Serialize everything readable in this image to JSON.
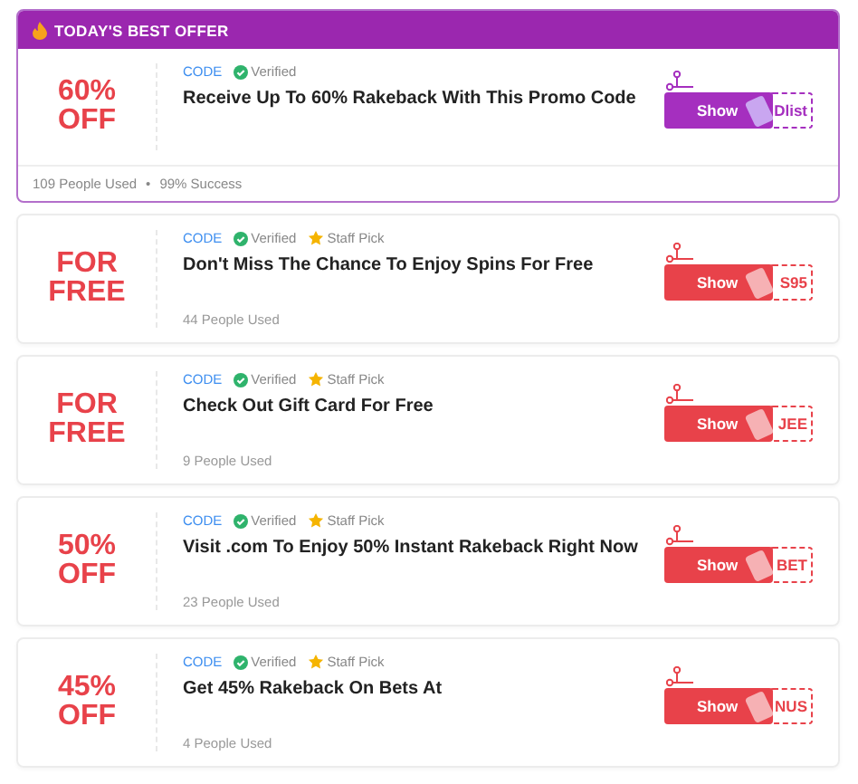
{
  "best_offer": {
    "header": "TODAY'S BEST OFFER",
    "discount": [
      "60%",
      "OFF"
    ],
    "tag": "CODE",
    "verified": "Verified",
    "title": "Receive Up To 60% Rakeback With This Promo Code",
    "button": "Show",
    "code": "Dlist",
    "used": "109 People Used",
    "separator": "•",
    "success": "99% Success"
  },
  "offers": [
    {
      "discount": [
        "FOR",
        "FREE"
      ],
      "tag": "CODE",
      "verified": "Verified",
      "staff_pick": "Staff Pick",
      "title": "Don't Miss The Chance To Enjoy Spins For Free",
      "used": "44 People Used",
      "button": "Show",
      "code": "S95"
    },
    {
      "discount": [
        "FOR",
        "FREE"
      ],
      "tag": "CODE",
      "verified": "Verified",
      "staff_pick": "Staff Pick",
      "title": "Check Out Gift Card For Free",
      "used": "9 People Used",
      "button": "Show",
      "code": "JEE"
    },
    {
      "discount": [
        "50%",
        "OFF"
      ],
      "tag": "CODE",
      "verified": "Verified",
      "staff_pick": "Staff Pick",
      "title": "Visit .com To Enjoy 50% Instant Rakeback Right Now",
      "used": "23 People Used",
      "button": "Show",
      "code": "BET"
    },
    {
      "discount": [
        "45%",
        "OFF"
      ],
      "tag": "CODE",
      "verified": "Verified",
      "staff_pick": "Staff Pick",
      "title": "Get 45% Rakeback On Bets At",
      "used": "4 People Used",
      "button": "Show",
      "code": "NUS"
    }
  ]
}
